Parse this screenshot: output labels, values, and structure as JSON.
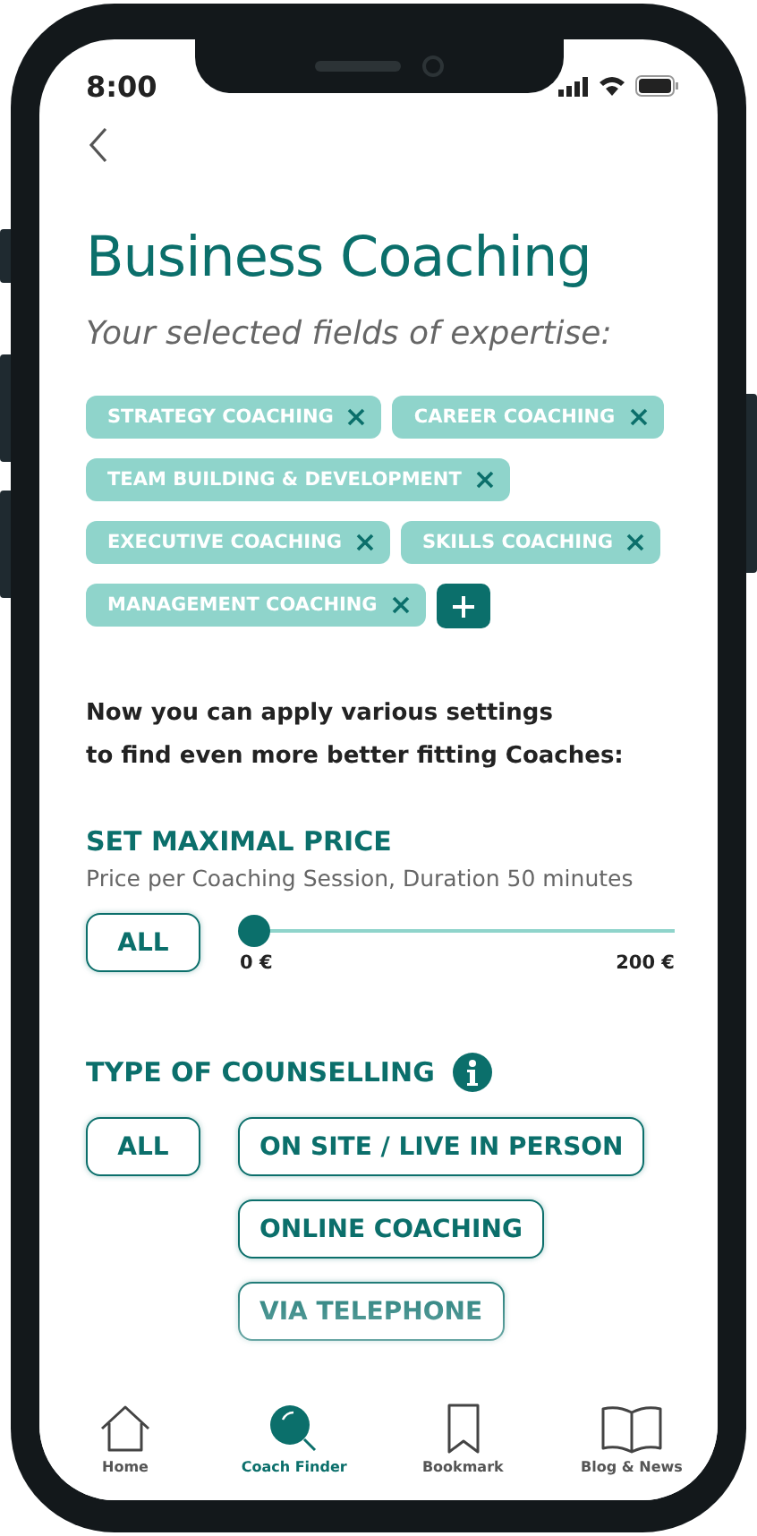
{
  "status_bar": {
    "time": "8:00"
  },
  "title": "Business Coaching",
  "subtitle": "Your selected fields of expertise:",
  "expertise_tags": [
    {
      "label": "STRATEGY COACHING"
    },
    {
      "label": "CAREER COACHING"
    },
    {
      "label": "TEAM BUILDING & DEVELOPMENT"
    },
    {
      "label": "EXECUTIVE COACHING"
    },
    {
      "label": "SKILLS COACHING"
    },
    {
      "label": "MANAGEMENT COACHING"
    }
  ],
  "intro": "Now you can apply various settings\nto find even more better fitting Coaches:",
  "price": {
    "heading": "SET MAXIMAL PRICE",
    "caption": "Price per Coaching Session, Duration 50 minutes",
    "all_button": "ALL",
    "level": 0,
    "min_label": "0 €",
    "max_label": "200 €"
  },
  "counselling": {
    "heading": "TYPE OF COUNSELLING",
    "all_button": "ALL",
    "options": [
      {
        "label": "ON SITE / LIVE IN PERSON"
      },
      {
        "label": "ONLINE COACHING"
      },
      {
        "label": "VIA TELEPHONE"
      }
    ]
  },
  "tab_bar": [
    {
      "kind": "home",
      "label": "Home",
      "selected": false
    },
    {
      "kind": "search",
      "label": "Coach Finder",
      "selected": true
    },
    {
      "kind": "bookmark",
      "label": "Bookmark",
      "selected": false
    },
    {
      "kind": "book",
      "label": "Blog & News",
      "selected": false
    }
  ]
}
